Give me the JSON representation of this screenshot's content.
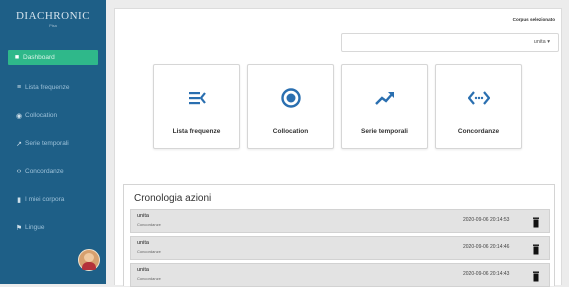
{
  "brand": {
    "title": "DIACHRONIC",
    "subtitle": "Pisa"
  },
  "sidebar": {
    "items": [
      {
        "label": "Dashboard",
        "icon": "dashboard-icon"
      },
      {
        "label": "Lista frequenze",
        "icon": "list-icon"
      },
      {
        "label": "Collocation",
        "icon": "circle-dot-icon"
      },
      {
        "label": "Serie temporali",
        "icon": "trend-icon"
      },
      {
        "label": "Concordanze",
        "icon": "code-icon"
      },
      {
        "label": "I miei corpora",
        "icon": "file-icon"
      },
      {
        "label": "Lingue",
        "icon": "flag-icon"
      }
    ]
  },
  "corpus": {
    "label": "Corpus selezionato",
    "selected": "unita"
  },
  "cards": [
    {
      "label": "Lista frequenze",
      "icon": "list-icon"
    },
    {
      "label": "Collocation",
      "icon": "circle-dot-icon"
    },
    {
      "label": "Serie temporali",
      "icon": "trend-icon"
    },
    {
      "label": "Concordanze",
      "icon": "code-icon"
    }
  ],
  "history": {
    "title": "Cronologia azioni",
    "rows": [
      {
        "name": "unita",
        "action": "Concordanze",
        "time": "2020-09-06 20:14:53"
      },
      {
        "name": "unita",
        "action": "Concordanze",
        "time": "2020-09-06 20:14:46"
      },
      {
        "name": "unita",
        "action": "Concordanze",
        "time": "2020-09-06 20:14:43"
      }
    ]
  },
  "colors": {
    "sidebar": "#1e5f87",
    "active": "#2fb88a",
    "accent": "#2a6fb0"
  }
}
